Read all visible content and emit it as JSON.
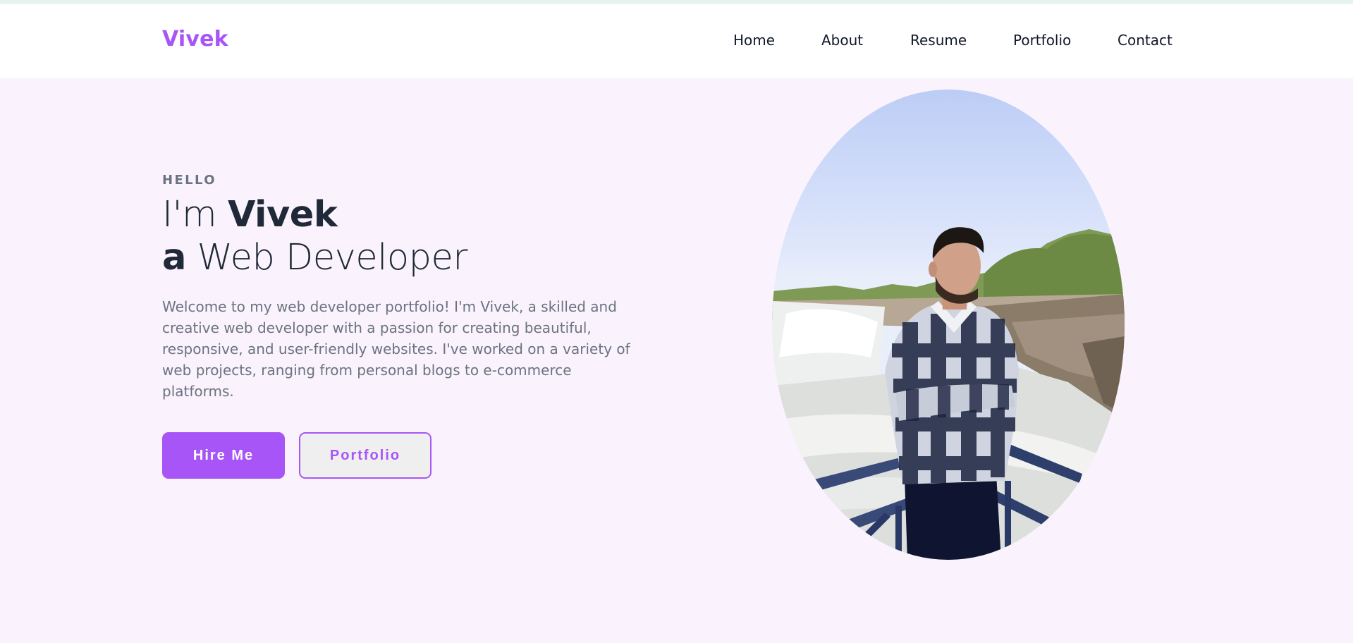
{
  "header": {
    "logo": "Vivek",
    "nav": [
      "Home",
      "About",
      "Resume",
      "Portfolio",
      "Contact"
    ]
  },
  "hero": {
    "eyebrow": "HELLO",
    "line1_prefix": "I'm ",
    "line1_name": "Vivek",
    "line2_article": "a",
    "line2_role": " Web Developer",
    "intro": "Welcome to my web developer portfolio! I'm Vivek, a skilled and creative web developer with a passion for creating beautiful, responsive, and user-friendly websites. I've worked on a variety of web projects, ranging from personal blogs to e-commerce platforms.",
    "hire_label": "Hire Me",
    "portfolio_label": "Portfolio"
  },
  "colors": {
    "accent": "#a855f7",
    "page_bg": "#faf3fd",
    "heading": "#1f2937",
    "body_text": "#6b7280"
  },
  "icons": {
    "profile_photo": "portrait-photo"
  }
}
